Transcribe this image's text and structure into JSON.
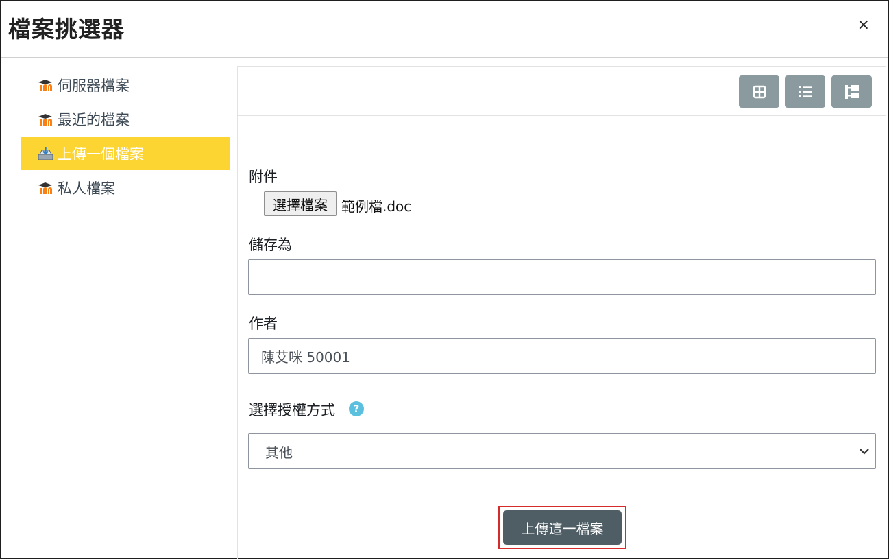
{
  "dialog": {
    "title": "檔案挑選器",
    "close_label": "×"
  },
  "sidebar": {
    "items": [
      {
        "label": "伺服器檔案",
        "icon": "moodle-icon",
        "active": false
      },
      {
        "label": "最近的檔案",
        "icon": "moodle-icon",
        "active": false
      },
      {
        "label": "上傳一個檔案",
        "icon": "upload-icon",
        "active": true
      },
      {
        "label": "私人檔案",
        "icon": "moodle-icon",
        "active": false
      }
    ]
  },
  "toolbar": {
    "buttons": [
      {
        "icon": "grid-view-icon"
      },
      {
        "icon": "list-view-icon"
      },
      {
        "icon": "tree-view-icon"
      }
    ]
  },
  "form": {
    "attachment_label": "附件",
    "choose_file_label": "選擇檔案",
    "file_name": "範例檔.doc",
    "save_as_label": "儲存為",
    "save_as_value": "",
    "author_label": "作者",
    "author_value": "陳艾咪 50001",
    "license_label": "選擇授權方式",
    "help_icon": "?",
    "license_value": "其他",
    "upload_label": "上傳這一檔案"
  },
  "colors": {
    "active_item": "#fcd532",
    "toolbar_button": "#8b9a9e",
    "upload_button": "#4f5d65",
    "highlight_border": "#d52b2b",
    "help_icon": "#5bc0de",
    "moodle_orange": "#f98012"
  }
}
